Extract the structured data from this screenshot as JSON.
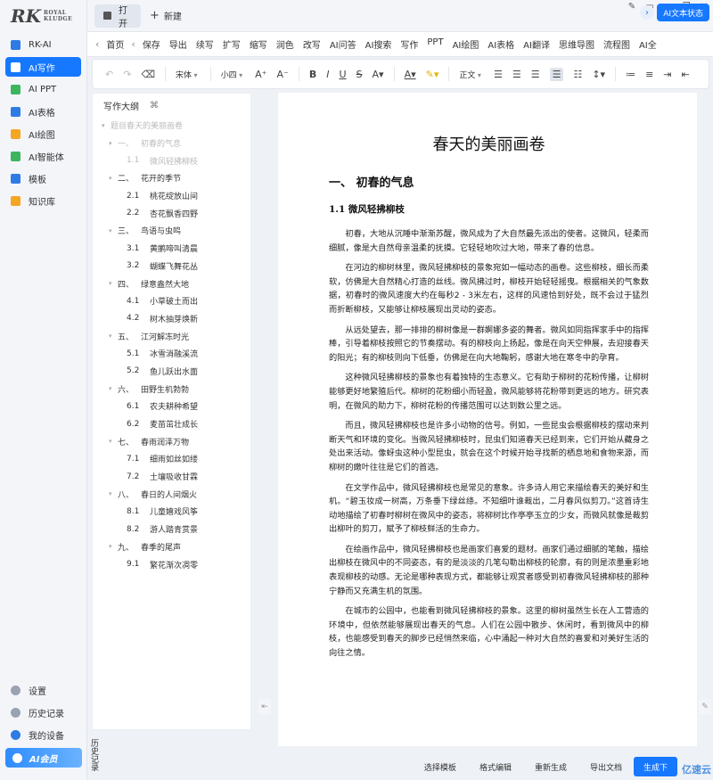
{
  "app": {
    "logo_main": "RK",
    "logo_sub": "ROYAL KLUDGE"
  },
  "nav": {
    "items": [
      {
        "label": "RK-AI",
        "color": "#2f7be5"
      },
      {
        "label": "AI写作",
        "color": "#ffffff"
      },
      {
        "label": "AI PPT",
        "color": "#3cb55e"
      },
      {
        "label": "AI表格",
        "color": "#2f7be5"
      },
      {
        "label": "AI绘图",
        "color": "#f5a623"
      },
      {
        "label": "AI智能体",
        "color": "#3cb55e"
      },
      {
        "label": "模板",
        "color": "#2f7be5"
      },
      {
        "label": "知识库",
        "color": "#f5a623"
      }
    ],
    "bottom": [
      {
        "label": "设置"
      },
      {
        "label": "历史记录"
      },
      {
        "label": "我的设备"
      }
    ],
    "vip_label": "AI会员"
  },
  "tabs": {
    "open_label": "打开",
    "new_label": "新建"
  },
  "menu": {
    "home": "首页",
    "items": [
      "保存",
      "导出",
      "续写",
      "扩写",
      "缩写",
      "润色",
      "改写",
      "AI问答",
      "AI搜索",
      "写作",
      "PPT",
      "AI绘图",
      "AI表格",
      "AI翻译",
      "思维导图",
      "流程图",
      "AI全"
    ],
    "ai_status": "AI文本状态"
  },
  "toolbar": {
    "font_family": "宋体",
    "font_size": "小四",
    "align_label": "正文"
  },
  "outline": {
    "title": "写作大纲",
    "cmd_icon": "⌘",
    "rows": [
      {
        "level": 0,
        "num": "题目",
        "text": "春天的美丽画卷",
        "muted": true
      },
      {
        "level": 1,
        "num": "一、",
        "text": "初春的气息",
        "muted": true
      },
      {
        "level": 2,
        "num": "1.1",
        "text": "微风轻拂柳枝",
        "muted": true
      },
      {
        "level": 1,
        "num": "二、",
        "text": "花开的季节"
      },
      {
        "level": 2,
        "num": "2.1",
        "text": "桃花绽放山间"
      },
      {
        "level": 2,
        "num": "2.2",
        "text": "杏花飘香四野"
      },
      {
        "level": 1,
        "num": "三、",
        "text": "鸟语与虫鸣"
      },
      {
        "level": 2,
        "num": "3.1",
        "text": "黄鹂啼叫清晨"
      },
      {
        "level": 2,
        "num": "3.2",
        "text": "蝴蝶飞舞花丛"
      },
      {
        "level": 1,
        "num": "四、",
        "text": "绿意盎然大地"
      },
      {
        "level": 2,
        "num": "4.1",
        "text": "小草破土而出"
      },
      {
        "level": 2,
        "num": "4.2",
        "text": "树木抽芽焕新"
      },
      {
        "level": 1,
        "num": "五、",
        "text": "江河解冻时光"
      },
      {
        "level": 2,
        "num": "5.1",
        "text": "冰雪消融溪流"
      },
      {
        "level": 2,
        "num": "5.2",
        "text": "鱼儿跃出水面"
      },
      {
        "level": 1,
        "num": "六、",
        "text": "田野生机勃勃"
      },
      {
        "level": 2,
        "num": "6.1",
        "text": "农夫耕种希望"
      },
      {
        "level": 2,
        "num": "6.2",
        "text": "麦苗茁壮成长"
      },
      {
        "level": 1,
        "num": "七、",
        "text": "春雨润泽万物"
      },
      {
        "level": 2,
        "num": "7.1",
        "text": "细雨如丝如缕"
      },
      {
        "level": 2,
        "num": "7.2",
        "text": "土壤吸收甘霖"
      },
      {
        "level": 1,
        "num": "八、",
        "text": "春日的人间烟火"
      },
      {
        "level": 2,
        "num": "8.1",
        "text": "儿童嬉戏风筝"
      },
      {
        "level": 2,
        "num": "8.2",
        "text": "游人踏青赏景"
      },
      {
        "level": 1,
        "num": "九、",
        "text": "春季的尾声"
      },
      {
        "level": 2,
        "num": "9.1",
        "text": "繁花渐次凋零"
      }
    ]
  },
  "history_label": "历史记录",
  "document": {
    "title": "春天的美丽画卷",
    "h2": "一、 初春的气息",
    "h3": "1.1 微风轻拂柳枝",
    "paragraphs": [
      "初春，大地从沉睡中渐渐苏醒，微风成为了大自然最先派出的使者。这微风，轻柔而细腻，像是大自然母亲温柔的抚摸。它轻轻地吹过大地，带来了春的信息。",
      "在河边的柳树林里，微风轻拂柳枝的景象宛如一幅动态的画卷。这些柳枝，细长而柔软，仿佛是大自然精心打造的丝线。微风拂过时，柳枝开始轻轻摇曳。根据相关的气象数据，初春时的微风速度大约在每秒2 - 3米左右，这样的风速恰到好处，既不会过于猛烈而折断柳枝，又能够让柳枝展现出灵动的姿态。",
      "从远处望去，那一排排的柳树像是一群婀娜多姿的舞者。微风如同指挥家手中的指挥棒，引导着柳枝按照它的节奏摆动。有的柳枝向上扬起，像是在向天空伸展，去迎接春天的阳光；有的柳枝则向下低垂，仿佛是在向大地鞠躬，感谢大地在寒冬中的孕育。",
      "这种微风轻拂柳枝的景象也有着独特的生态意义。它有助于柳树的花粉传播，让柳树能够更好地繁殖后代。柳树的花粉细小而轻盈，微风能够将花粉带到更远的地方。研究表明，在微风的助力下，柳树花粉的传播范围可以达到数公里之远。",
      "而且，微风轻拂柳枝也是许多小动物的信号。例如，一些昆虫会根据柳枝的摆动来判断天气和环境的变化。当微风轻拂柳枝时，昆虫们知道春天已经到来，它们开始从藏身之处出来活动。像蚜虫这种小型昆虫，就会在这个时候开始寻找新的栖息地和食物来源，而柳树的嫩叶往往是它们的首选。",
      "在文学作品中，微风轻拂柳枝也是常见的意象。许多诗人用它来描绘春天的美好和生机。“碧玉妆成一树高，万条垂下绿丝绦。不知细叶谁裁出，二月春风似剪刀。”这首诗生动地描绘了初春时柳树在微风中的姿态，将柳树比作亭亭玉立的少女，而微风就像是裁剪出柳叶的剪刀，赋予了柳枝鲜活的生命力。",
      "在绘画作品中，微风轻拂柳枝也是画家们喜爱的题材。画家们通过细腻的笔触，描绘出柳枝在微风中的不同姿态，有的是淡淡的几笔勾勒出柳枝的轮廓，有的则是浓墨重彩地表现柳枝的动感。无论是哪种表现方式，都能够让观赏者感受到初春微风轻拂柳枝的那种宁静而又充满生机的氛围。",
      "在城市的公园中，也能看到微风轻拂柳枝的景象。这里的柳树虽然生长在人工营造的环境中，但依然能够展现出春天的气息。人们在公园中散步、休闲时，看到微风中的柳枝，也能感受到春天的脚步已经悄然来临，心中涌起一种对大自然的喜爱和对美好生活的向往之情。"
    ]
  },
  "bottom": {
    "choose_template": "选择模板",
    "format_edit": "格式编辑",
    "regenerate": "重新生成",
    "export_doc": "导出文档",
    "generate": "生成下",
    "watermark": "亿速云"
  }
}
